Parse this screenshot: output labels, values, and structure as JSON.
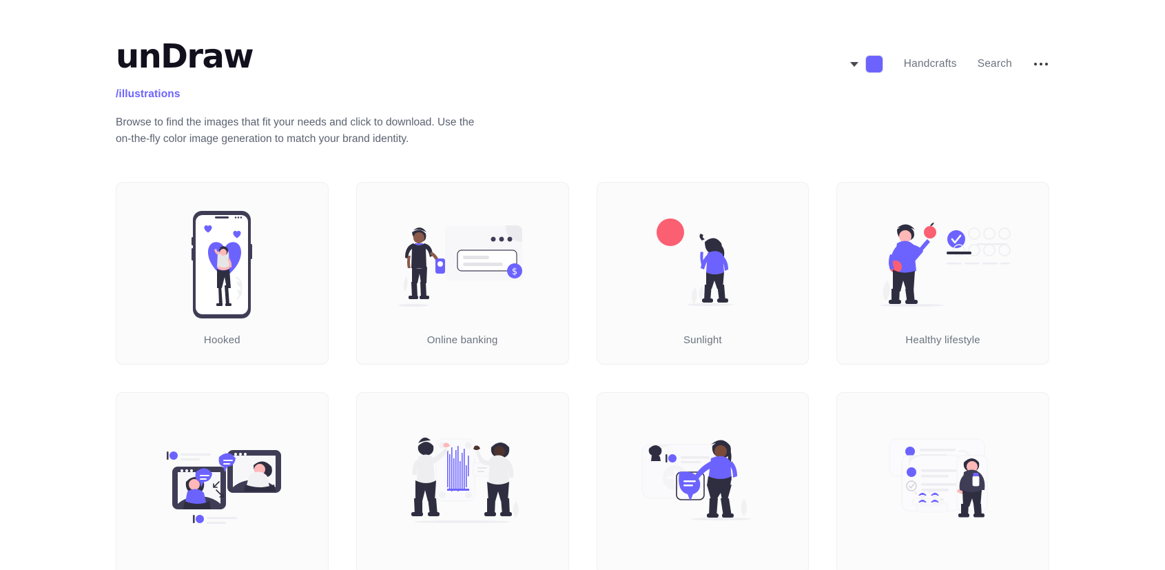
{
  "header": {
    "brand": "unDraw",
    "subtitle": "/illustrations",
    "description": "Browse to find the images that fit your needs and click to download. Use the on-the-fly color image generation to match your brand identity.",
    "nav": {
      "caret_icon": "chevron-down-icon",
      "color_swatch": {
        "icon": "color-swatch",
        "color": "#6c63ff"
      },
      "links": [
        {
          "label": "Handcrafts"
        },
        {
          "label": "Search"
        }
      ],
      "more_icon": "ellipsis-icon"
    }
  },
  "colors": {
    "accent": "#6c63ff",
    "ink": "#3f3d56",
    "skin": "#ffb8b8",
    "skin_dark": "#a0616a",
    "red": "#fb5f72",
    "card_bg": "#fafbfa",
    "card_border": "#f0f0f0",
    "text_muted": "#6b7280"
  },
  "gallery": {
    "items": [
      {
        "title": "Hooked",
        "art": "hooked"
      },
      {
        "title": "Online banking",
        "art": "online-banking"
      },
      {
        "title": "Sunlight",
        "art": "sunlight"
      },
      {
        "title": "Healthy lifestyle",
        "art": "healthy-lifestyle"
      },
      {
        "title": "",
        "art": "video-call"
      },
      {
        "title": "",
        "art": "data-board"
      },
      {
        "title": "",
        "art": "social-messaging"
      },
      {
        "title": "",
        "art": "task-cards"
      }
    ]
  }
}
